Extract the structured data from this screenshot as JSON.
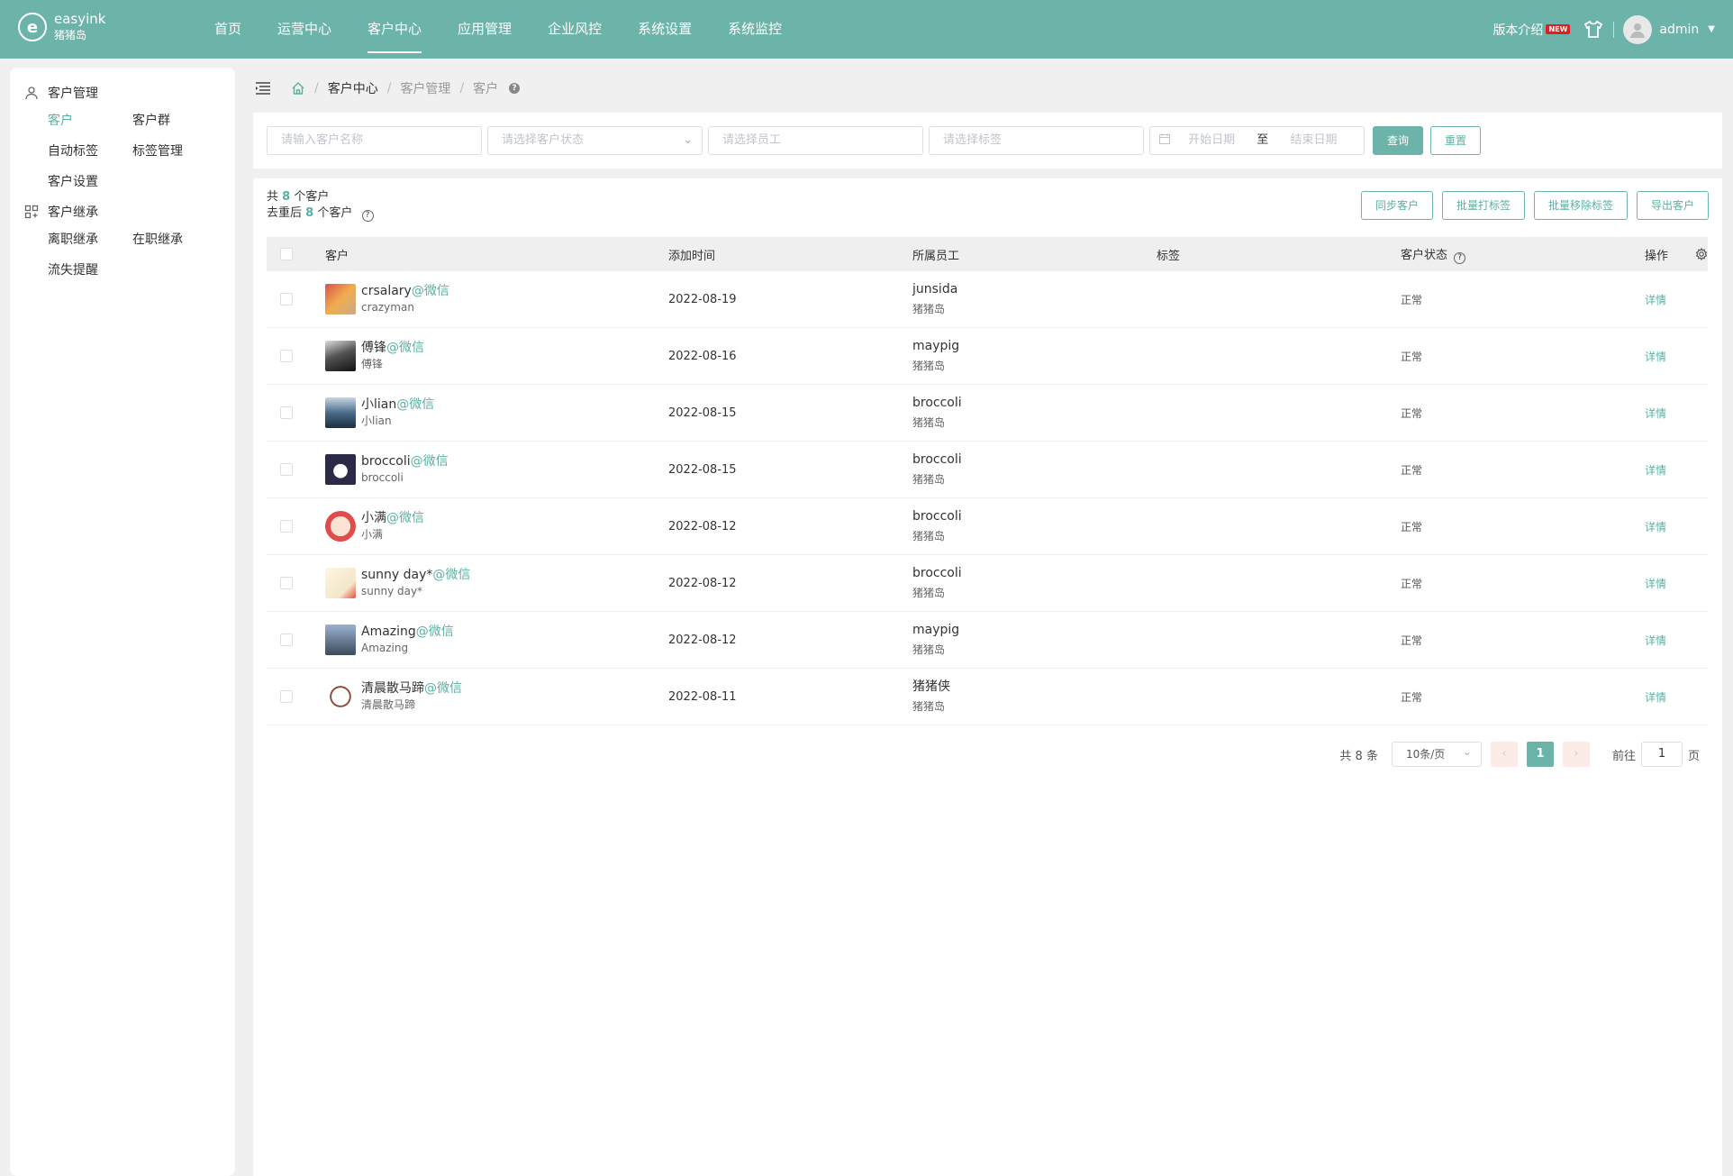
{
  "header": {
    "logo_name": "easyink",
    "logo_sub": "猪猪岛",
    "nav": [
      "首页",
      "运营中心",
      "客户中心",
      "应用管理",
      "企业风控",
      "系统设置",
      "系统监控"
    ],
    "active_nav": 2,
    "version_label": "版本介绍",
    "new_badge": "NEW",
    "user": "admin"
  },
  "sidebar": {
    "group1": "客户管理",
    "group1_items": [
      "客户",
      "客户群",
      "自动标签",
      "标签管理",
      "客户设置"
    ],
    "group2": "客户继承",
    "group2_items": [
      "离职继承",
      "在职继承",
      "流失提醒"
    ]
  },
  "breadcrumb": [
    "客户中心",
    "客户管理",
    "客户"
  ],
  "filters": {
    "name_placeholder": "请输入客户名称",
    "status_placeholder": "请选择客户状态",
    "employee_placeholder": "请选择员工",
    "tag_placeholder": "请选择标签",
    "start_date": "开始日期",
    "date_sep": "至",
    "end_date": "结束日期",
    "query": "查询",
    "reset": "重置"
  },
  "summary": {
    "line1_pre": "共",
    "total": "8",
    "line1_post": "个客户",
    "line2_pre": "去重后",
    "dedup": "8",
    "line2_post": "个客户"
  },
  "actions": [
    "同步客户",
    "批量打标签",
    "批量移除标签",
    "导出客户"
  ],
  "table": {
    "headers": [
      "客户",
      "添加时间",
      "所属员工",
      "标签",
      "客户状态",
      "操作"
    ],
    "wx_suffix": "@微信",
    "rows": [
      {
        "name": "crsalary",
        "sub": "crazyman",
        "time": "2022-08-19",
        "emp": "junsida",
        "org": "猪猪岛",
        "status": "正常",
        "op": "详情"
      },
      {
        "name": "傅锋",
        "sub": "傅锋",
        "time": "2022-08-16",
        "emp": "maypig",
        "org": "猪猪岛",
        "status": "正常",
        "op": "详情"
      },
      {
        "name": "小lian",
        "sub": "小lian",
        "time": "2022-08-15",
        "emp": "broccoli",
        "org": "猪猪岛",
        "status": "正常",
        "op": "详情"
      },
      {
        "name": "broccoli",
        "sub": "broccoli",
        "time": "2022-08-15",
        "emp": "broccoli",
        "org": "猪猪岛",
        "status": "正常",
        "op": "详情"
      },
      {
        "name": "小满",
        "sub": "小满",
        "time": "2022-08-12",
        "emp": "broccoli",
        "org": "猪猪岛",
        "status": "正常",
        "op": "详情"
      },
      {
        "name": "sunny day*",
        "sub": "sunny day*",
        "time": "2022-08-12",
        "emp": "broccoli",
        "org": "猪猪岛",
        "status": "正常",
        "op": "详情"
      },
      {
        "name": "Amazing",
        "sub": "Amazing",
        "time": "2022-08-12",
        "emp": "maypig",
        "org": "猪猪岛",
        "status": "正常",
        "op": "详情"
      },
      {
        "name": "清晨散马蹄",
        "sub": "清晨散马蹄",
        "time": "2022-08-11",
        "emp": "猪猪侠",
        "org": "猪猪岛",
        "status": "正常",
        "op": "详情"
      }
    ]
  },
  "pager": {
    "total_text": "共 8 条",
    "page_size": "10条/页",
    "current": "1",
    "prev": "‹",
    "next": "›",
    "goto_pre": "前往",
    "goto_value": "1",
    "goto_post": "页"
  },
  "colors": {
    "primary": "#6cb3a9",
    "link": "#5ab0a3"
  }
}
